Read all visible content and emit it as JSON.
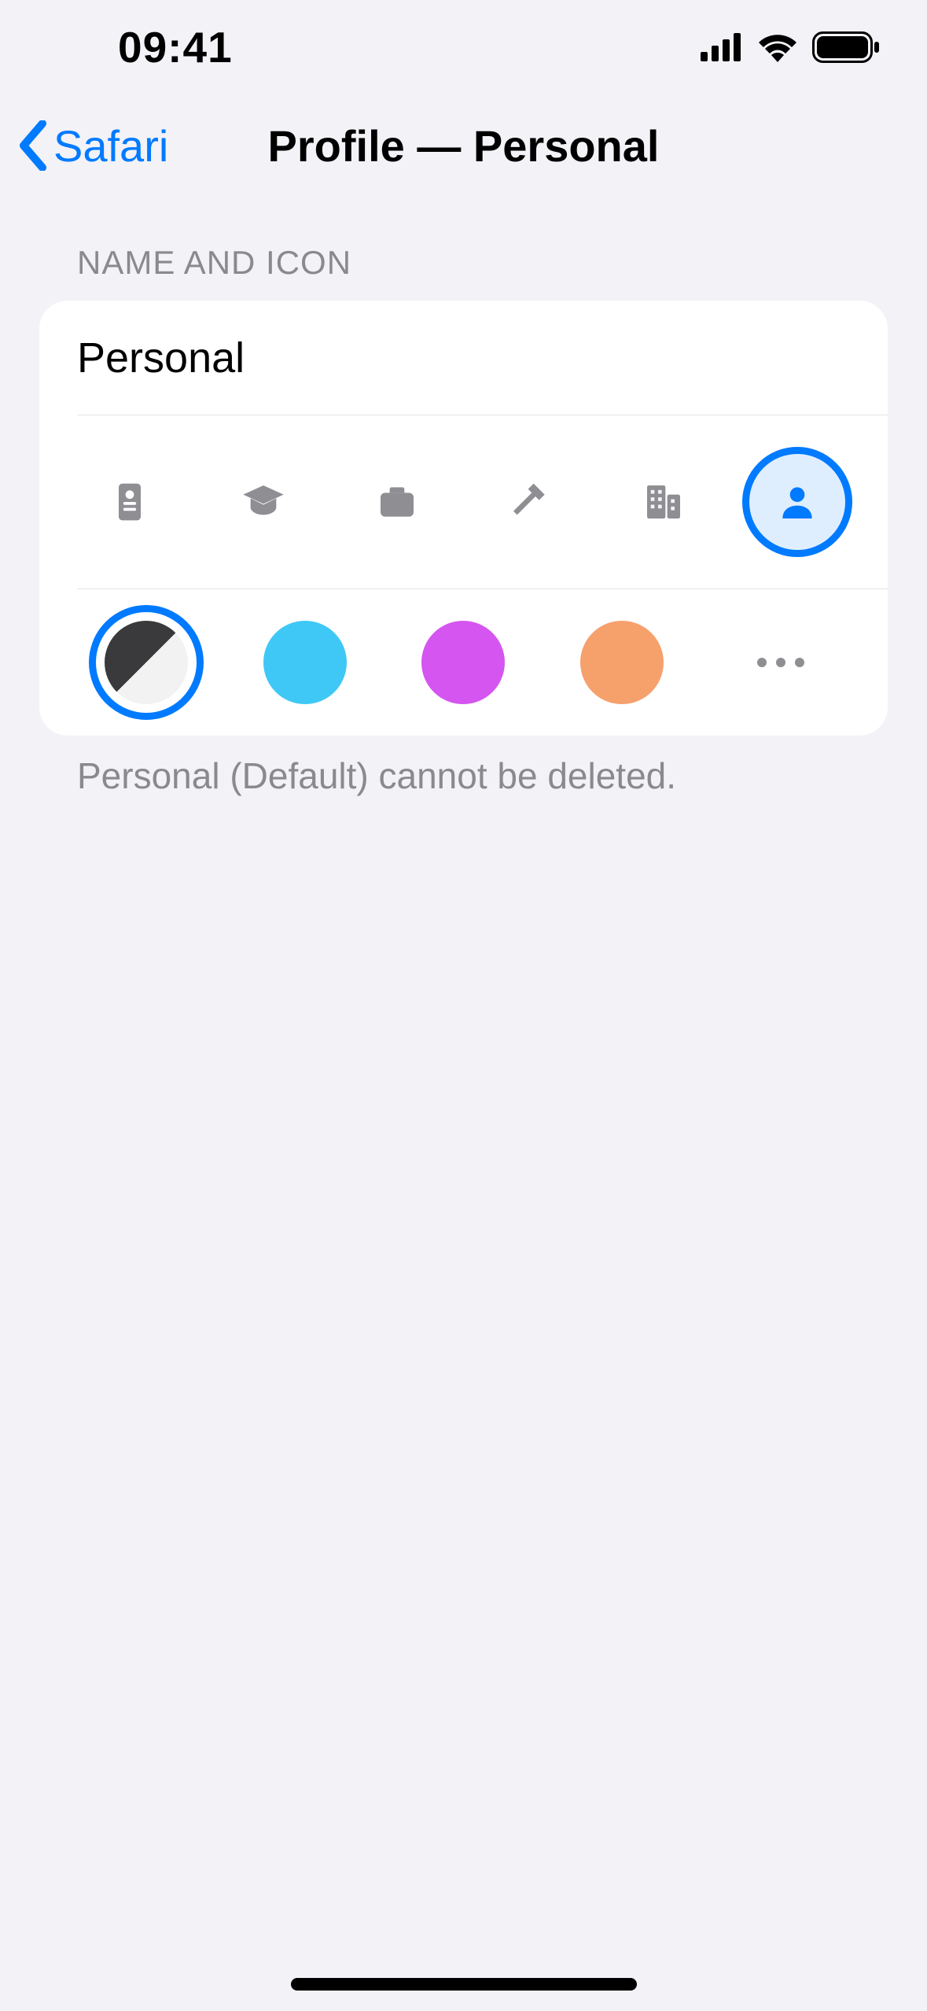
{
  "status": {
    "time": "09:41"
  },
  "nav": {
    "back_label": "Safari",
    "title": "Profile — Personal"
  },
  "section": {
    "header": "NAME AND ICON",
    "name_value": "Personal",
    "footer": "Personal (Default) cannot be deleted."
  },
  "icons": [
    {
      "name": "badge",
      "selected": false
    },
    {
      "name": "graduation",
      "selected": false
    },
    {
      "name": "briefcase",
      "selected": false
    },
    {
      "name": "hammer",
      "selected": false
    },
    {
      "name": "building",
      "selected": false
    },
    {
      "name": "person",
      "selected": true
    }
  ],
  "colors": [
    {
      "name": "system",
      "css": "",
      "selected": true
    },
    {
      "name": "blue",
      "css": "#3fc8f5",
      "selected": false
    },
    {
      "name": "purple",
      "css": "#d555f0",
      "selected": false
    },
    {
      "name": "orange",
      "css": "#f6a06c",
      "selected": false
    },
    {
      "name": "more",
      "css": "",
      "selected": false
    }
  ]
}
